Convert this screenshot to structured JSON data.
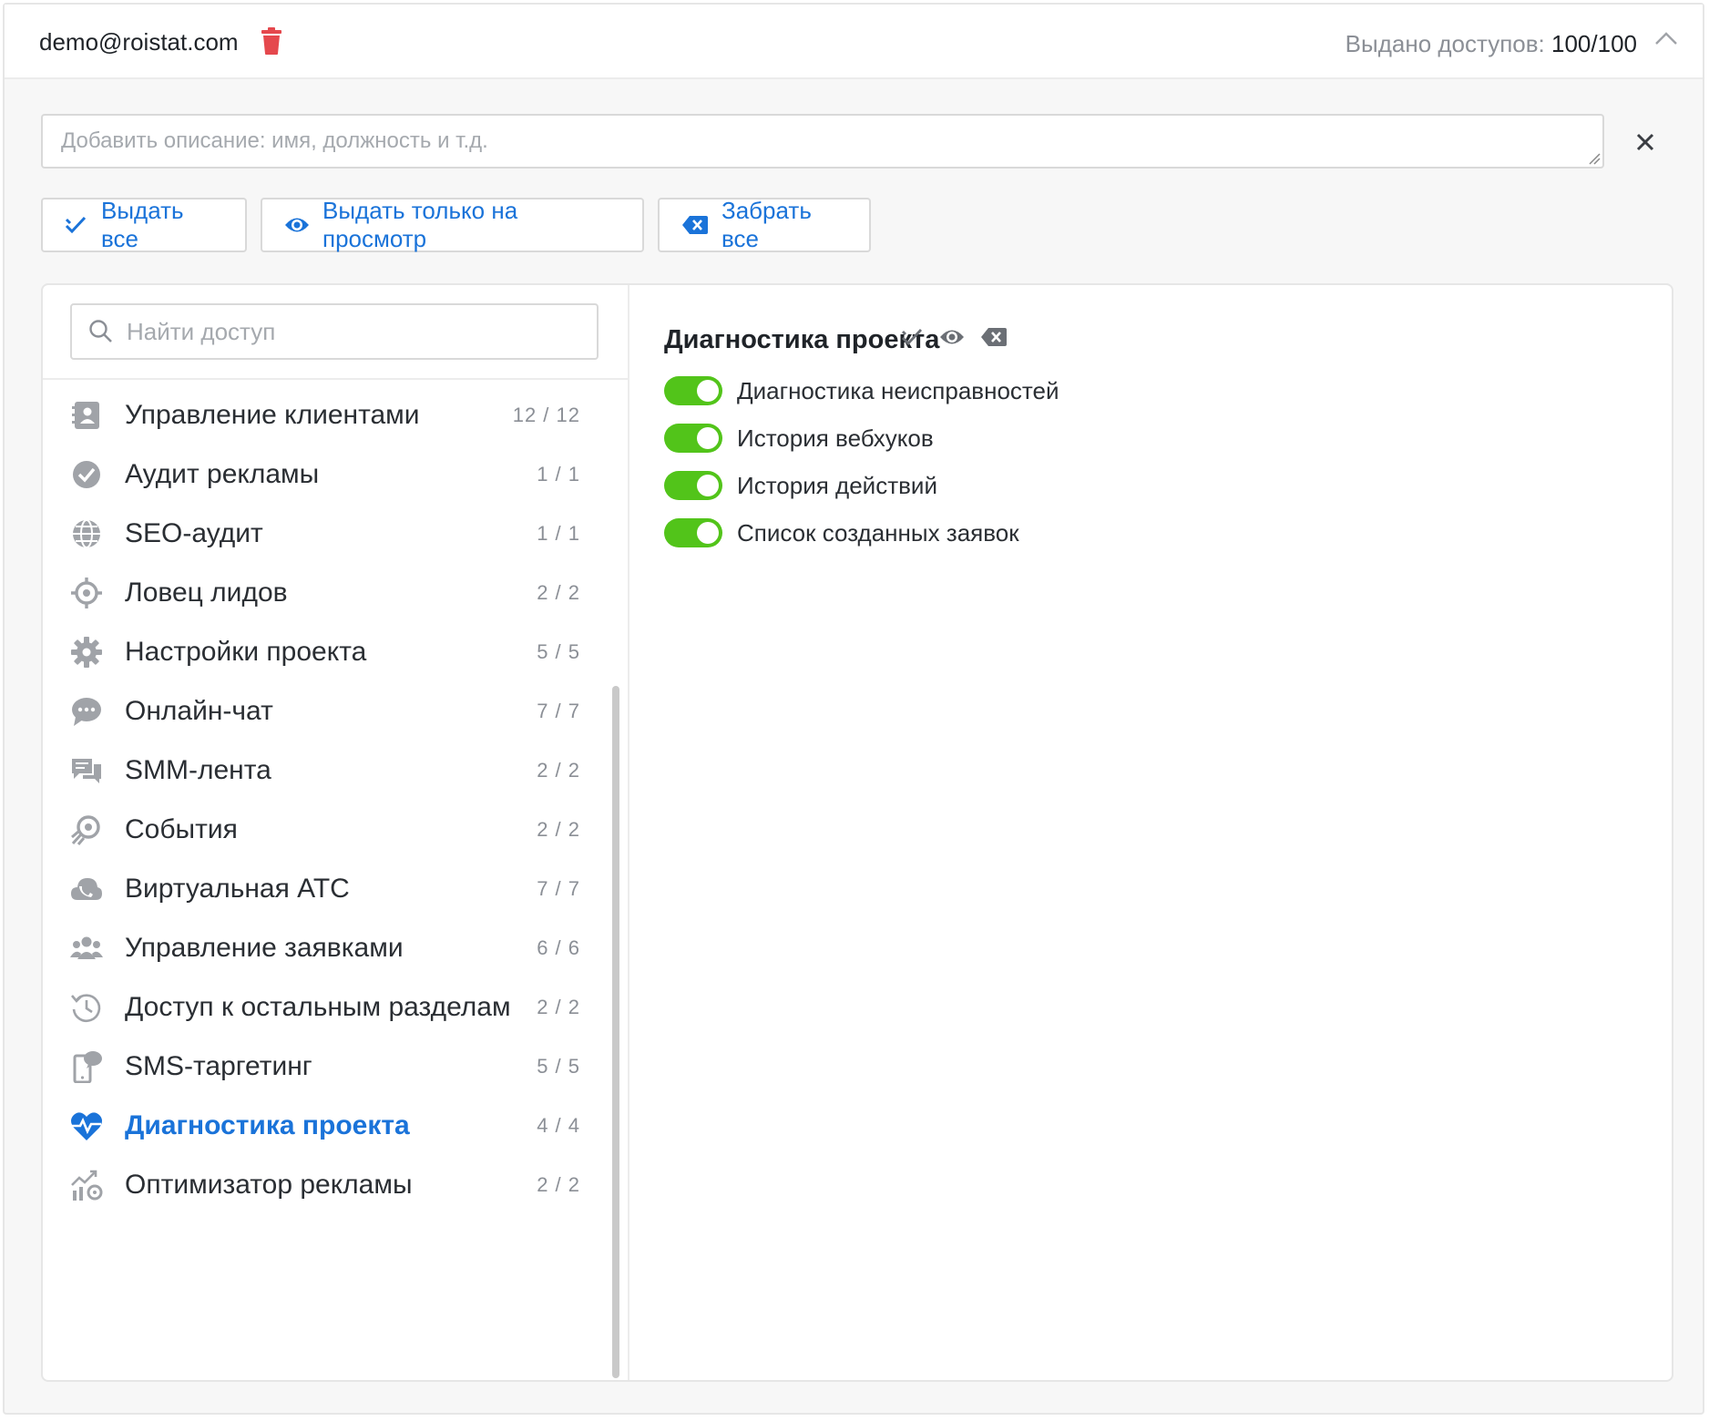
{
  "header": {
    "email": "demo@roistat.com",
    "quota_label": "Выдано доступов:",
    "quota_value": "100/100"
  },
  "description": {
    "placeholder": "Добавить описание: имя, должность и т.д."
  },
  "actions": {
    "grant_all": "Выдать все",
    "grant_view": "Выдать только на просмотр",
    "revoke_all": "Забрать все"
  },
  "search": {
    "placeholder": "Найти доступ"
  },
  "sections": [
    {
      "label": "Управление клиентами",
      "count": "12 / 12",
      "icon": "contacts-icon"
    },
    {
      "label": "Аудит рекламы",
      "count": "1 / 1",
      "icon": "check-circle-icon"
    },
    {
      "label": "SEO-аудит",
      "count": "1 / 1",
      "icon": "globe-icon"
    },
    {
      "label": "Ловец лидов",
      "count": "2 / 2",
      "icon": "crosshair-icon"
    },
    {
      "label": "Настройки проекта",
      "count": "5 / 5",
      "icon": "gear-icon"
    },
    {
      "label": "Онлайн-чат",
      "count": "7 / 7",
      "icon": "chat-bubble-icon"
    },
    {
      "label": "SMM-лента",
      "count": "2 / 2",
      "icon": "messages-icon"
    },
    {
      "label": "События",
      "count": "2 / 2",
      "icon": "rocket-icon"
    },
    {
      "label": "Виртуальная АТС",
      "count": "7 / 7",
      "icon": "phone-cloud-icon"
    },
    {
      "label": "Управление заявками",
      "count": "6 / 6",
      "icon": "users-icon"
    },
    {
      "label": "Доступ к остальным разделам",
      "count": "2 / 2",
      "icon": "history-icon"
    },
    {
      "label": "SMS-таргетинг",
      "count": "5 / 5",
      "icon": "sms-phone-icon"
    },
    {
      "label": "Диагностика проекта",
      "count": "4 / 4",
      "icon": "heart-pulse-icon",
      "active": true
    },
    {
      "label": "Оптимизатор рекламы",
      "count": "2 / 2",
      "icon": "chart-gear-icon"
    }
  ],
  "detail": {
    "title": "Диагностика проекта",
    "permissions": [
      {
        "label": "Диагностика неисправностей",
        "enabled": true
      },
      {
        "label": "История вебхуков",
        "enabled": true
      },
      {
        "label": "История действий",
        "enabled": true
      },
      {
        "label": "Список созданных заявок",
        "enabled": true
      }
    ]
  },
  "colors": {
    "accent": "#1a73d9",
    "toggle_on": "#52c41a",
    "danger": "#e5484d",
    "icon_gray": "#a0a3a8"
  }
}
